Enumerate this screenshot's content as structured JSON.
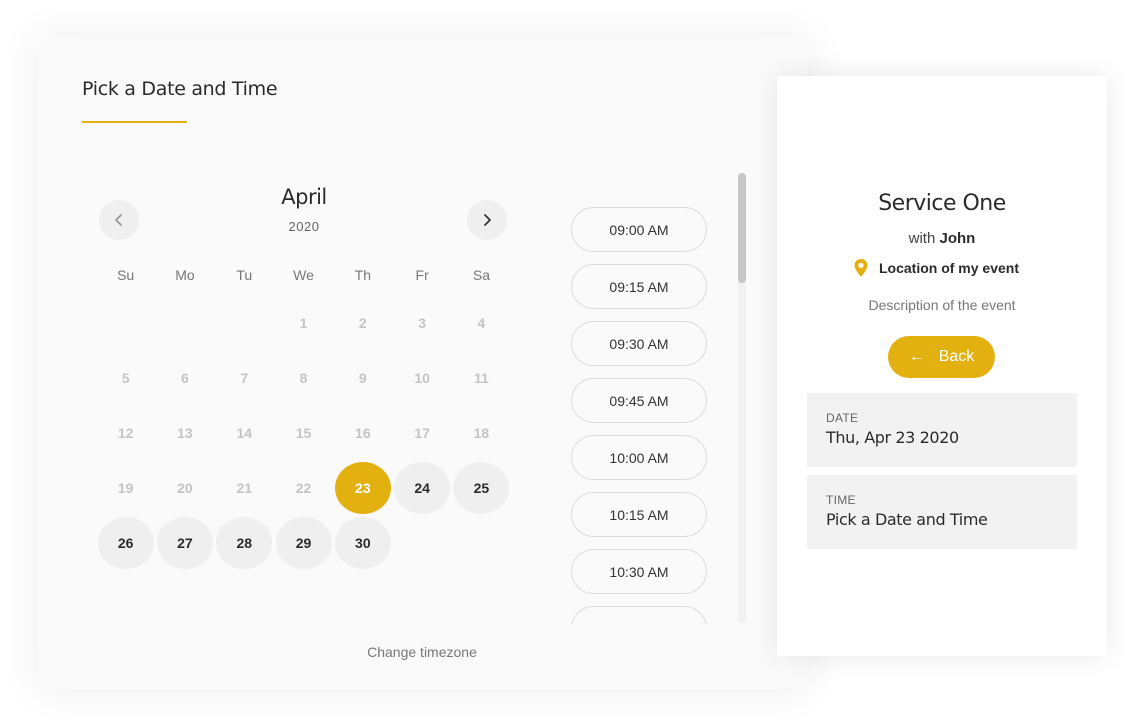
{
  "booking": {
    "title": "Pick a Date and Time",
    "calendar": {
      "month": "April",
      "year": "2020",
      "prev_icon": "chevron-left-icon",
      "next_icon": "chevron-right-icon",
      "weekdays": [
        "Su",
        "Mo",
        "Tu",
        "We",
        "Th",
        "Fr",
        "Sa"
      ],
      "days": [
        {
          "label": "",
          "state": "empty"
        },
        {
          "label": "",
          "state": "empty"
        },
        {
          "label": "",
          "state": "empty"
        },
        {
          "label": "1",
          "state": "disabled"
        },
        {
          "label": "2",
          "state": "disabled"
        },
        {
          "label": "3",
          "state": "disabled"
        },
        {
          "label": "4",
          "state": "disabled"
        },
        {
          "label": "5",
          "state": "disabled"
        },
        {
          "label": "6",
          "state": "disabled"
        },
        {
          "label": "7",
          "state": "disabled"
        },
        {
          "label": "8",
          "state": "disabled"
        },
        {
          "label": "9",
          "state": "disabled"
        },
        {
          "label": "10",
          "state": "disabled"
        },
        {
          "label": "11",
          "state": "disabled"
        },
        {
          "label": "12",
          "state": "disabled"
        },
        {
          "label": "13",
          "state": "disabled"
        },
        {
          "label": "14",
          "state": "disabled"
        },
        {
          "label": "15",
          "state": "disabled"
        },
        {
          "label": "16",
          "state": "disabled"
        },
        {
          "label": "17",
          "state": "disabled"
        },
        {
          "label": "18",
          "state": "disabled"
        },
        {
          "label": "19",
          "state": "disabled"
        },
        {
          "label": "20",
          "state": "disabled"
        },
        {
          "label": "21",
          "state": "disabled"
        },
        {
          "label": "22",
          "state": "disabled"
        },
        {
          "label": "23",
          "state": "selected"
        },
        {
          "label": "24",
          "state": "available"
        },
        {
          "label": "25",
          "state": "available"
        },
        {
          "label": "26",
          "state": "available"
        },
        {
          "label": "27",
          "state": "available"
        },
        {
          "label": "28",
          "state": "available"
        },
        {
          "label": "29",
          "state": "available"
        },
        {
          "label": "30",
          "state": "available"
        }
      ]
    },
    "timezone_link": "Change timezone",
    "time_slots": [
      "09:00 AM",
      "09:15 AM",
      "09:30 AM",
      "09:45 AM",
      "10:00 AM",
      "10:15 AM",
      "10:30 AM",
      ""
    ]
  },
  "event": {
    "service_name": "Service One",
    "with_prefix": "with",
    "host": "John",
    "location_icon": "map-pin-icon",
    "location": "Location of my event",
    "description": "Description of the event",
    "back_arrow": "←",
    "back_label": "Back",
    "date_label": "DATE",
    "date_value": "Thu, Apr 23 2020",
    "time_label": "TIME",
    "time_value": "Pick a Date and Time"
  },
  "colors": {
    "accent": "#e2b00f",
    "panel": "#fafafa",
    "day_available": "#efefef",
    "info_box": "#f2f2f2"
  }
}
